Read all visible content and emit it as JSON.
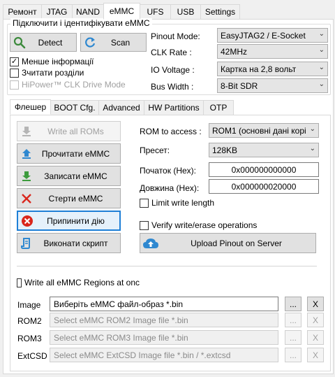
{
  "top_tabs": [
    "Ремонт",
    "JTAG",
    "NAND",
    "eMMC",
    "UFS",
    "USB",
    "Settings"
  ],
  "connect_group": {
    "title": "Підключити і ідентифікувати eMMC",
    "detect_label": "Detect",
    "scan_label": "Scan",
    "less_info_label": "Менше інформації",
    "less_info_checked": true,
    "read_partitions_label": "Зчитати розділи",
    "read_partitions_checked": false,
    "hipower_label": "HiPower™ CLK Drive Mode",
    "hipower_checked": false
  },
  "settings": {
    "pinout_label": "Pinout Mode:",
    "pinout_value": "EasyJTAG2 / E-Socket",
    "clk_label": "CLK Rate :",
    "clk_value": "42MHz",
    "io_label": "IO Voltage :",
    "io_value": "Картка на 2,8 вольт",
    "bus_label": "Bus Width :",
    "bus_value": "8-Bit SDR"
  },
  "sub_tabs": [
    "Флешер",
    "BOOT Cfg.",
    "Advanced",
    "HW Partitions",
    "OTP"
  ],
  "flasher": {
    "write_all_roms": "Write all ROMs",
    "read_emmc": "Прочитати eMMC",
    "write_emmc": "Записати eMMC",
    "erase_emmc": "Стерти eMMC",
    "stop_action": "Припинити дію",
    "run_script": "Виконати скрипт",
    "rom_access_label": "ROM to access :",
    "rom_access_value": "ROM1 (основні дані корі",
    "preset_label": "Пресет:",
    "preset_value": "128KB",
    "start_label": "Початок (Hex):",
    "start_value": "0x000000000000",
    "length_label": "Довжина (Hex):",
    "length_value": "0x000000020000",
    "limit_write_label": "Limit write length",
    "verify_label": "Verify write/erase operations",
    "upload_pinout_label": "Upload Pinout on Server",
    "write_all_regions_label": "Write all eMMC Regions at onc"
  },
  "images": {
    "image_label": "Image",
    "image_value": "Виберіть eMMC файл-образ *.bin",
    "rom2_label": "ROM2",
    "rom2_placeholder": "Select eMMC ROM2 Image file *.bin",
    "rom3_label": "ROM3",
    "rom3_placeholder": "Select eMMC ROM3 Image file *.bin",
    "extcsd_label": "ExtCSD",
    "extcsd_placeholder": "Select eMMC ExtCSD Image file *.bin / *.extcsd",
    "browse_label": "...",
    "clear_label": "X"
  },
  "colors": {
    "accent": "#1e7fd6",
    "green_arrow": "#3c9b3c",
    "red": "#d9261c",
    "upload_blue": "#2f88d0"
  }
}
